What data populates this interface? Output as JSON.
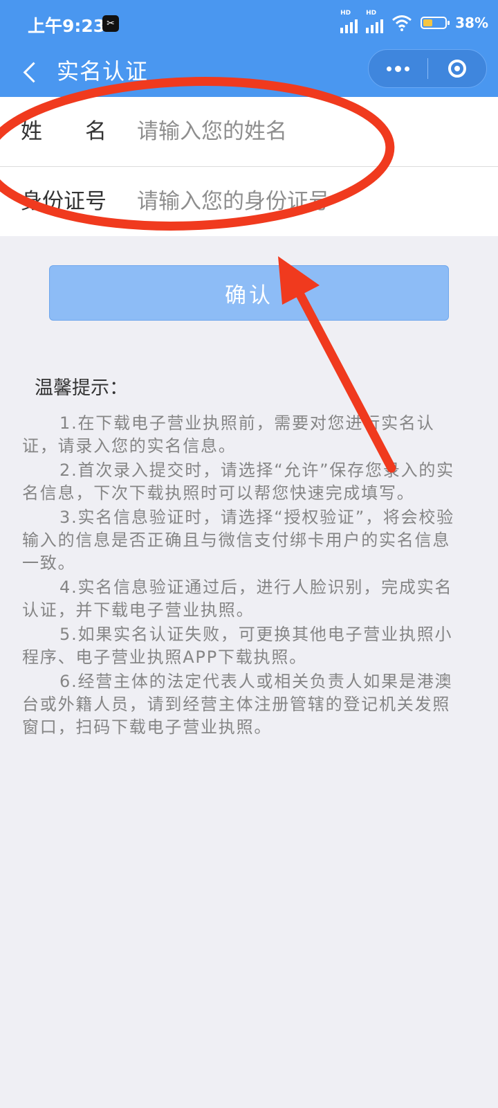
{
  "status_bar": {
    "time": "上午9:23",
    "network_label_1": "HD",
    "network_label_2": "HD",
    "battery": "38%"
  },
  "navbar": {
    "title": "实名认证"
  },
  "form": {
    "name_label": "姓名",
    "name_placeholder": "请输入您的姓名",
    "id_label": "身份证号",
    "id_placeholder": "请输入您的身份证号"
  },
  "confirm_label": "确认",
  "tips": {
    "title": "温馨提示：",
    "items": [
      "1.在下载电子营业执照前，需要对您进行实名认证，请录入您的实名信息。",
      "2.首次录入提交时，请选择“允许”保存您录入的实名信息，下次下载执照时可以帮您快速完成填写。",
      "3.实名信息验证时，请选择“授权验证”，将会校验输入的信息是否正确且与微信支付绑卡用户的实名信息一致。",
      "4.实名信息验证通过后，进行人脸识别，完成实名认证，并下载电子营业执照。",
      "5.如果实名认证失败，可更换其他电子营业执照小程序、电子营业执照APP下载执照。",
      "6.经营主体的法定代表人或相关负责人如果是港澳台或外籍人员，请到经营主体注册管辖的登记机关发照窗口，扫码下载电子营业执照。"
    ]
  },
  "colors": {
    "header": "#4a97f0",
    "button": "#8dbcf6",
    "annotation": "#f03a1e"
  }
}
